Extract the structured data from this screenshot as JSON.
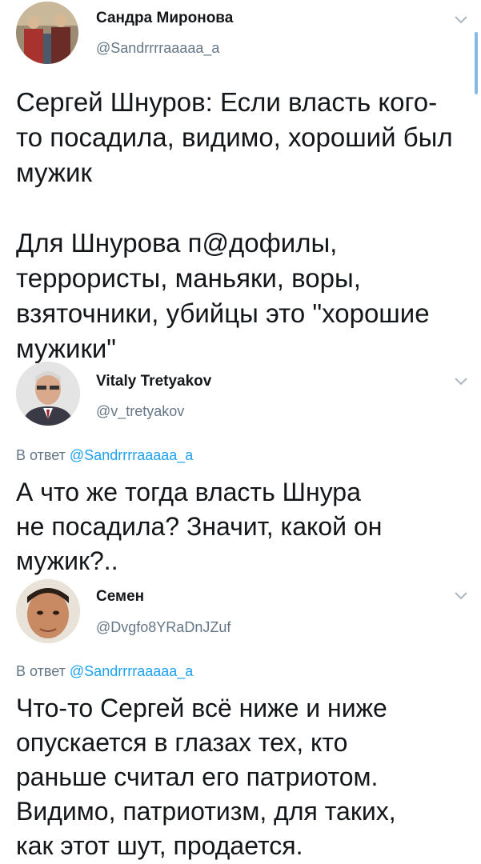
{
  "tweets": [
    {
      "name": "Сандра Миронова",
      "handle": "@Sandrrrraaaaa_a",
      "text": "Сергей Шнуров: Если власть кого-\nто посадила, видимо, хороший был\nмужик\n\nДля Шнурова п@дофилы,\nтеррористы, маньяки, воры,\nвзяточники, убийцы это \"хорошие\nмужики\""
    },
    {
      "name": "Vitaly Tretyakov",
      "handle": "@v_tretyakov",
      "reply_prefix": "В ответ",
      "reply_handle": "@Sandrrrraaaaa_a",
      "text": "А что же тогда власть Шнура\nне посадила? Значит, какой он\nмужик?.."
    },
    {
      "name": "Семен",
      "handle": "@Dvgfo8YRaDnJZuf",
      "reply_prefix": "В ответ",
      "reply_handle": "@Sandrrrraaaaa_a",
      "text": "Что-то Сергей всё ниже и ниже\nопускается в глазах тех, кто\nраньше считал его патриотом.\nВидимо, патриотизм, для таких,\nкак этот шут, продается."
    }
  ],
  "icons": {
    "menu": "chevron-down-icon"
  },
  "colors": {
    "link": "#1da1f2",
    "secondary": "#657786",
    "text": "#14171a"
  }
}
